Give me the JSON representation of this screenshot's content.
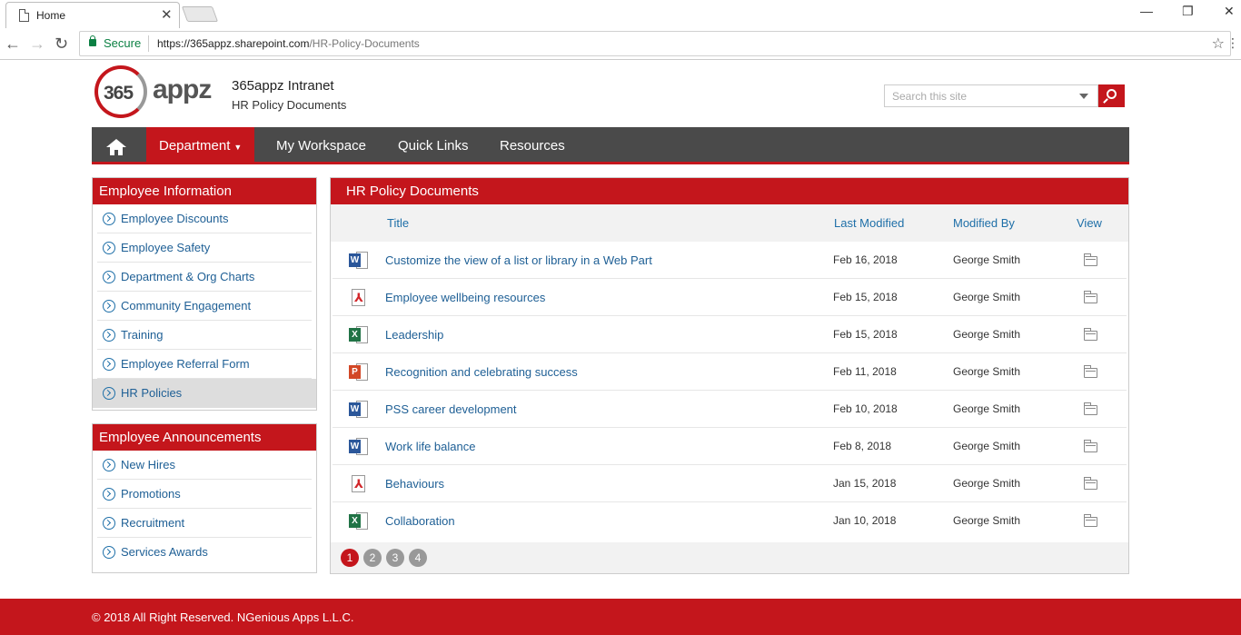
{
  "browser": {
    "tab_title": "Home",
    "secure_label": "Secure",
    "url_scheme_domain": "https://365appz.sharepoint.com",
    "url_path": "/HR-Policy-Documents"
  },
  "header": {
    "logo_number": "365",
    "logo_word": "appz",
    "site_title": "365appz Intranet",
    "site_subtitle": "HR Policy Documents",
    "search_placeholder": "Search this site"
  },
  "nav": {
    "items": [
      {
        "label": "Department"
      },
      {
        "label": "My Workspace"
      },
      {
        "label": "Quick Links"
      },
      {
        "label": "Resources"
      }
    ]
  },
  "employee_info": {
    "heading": "Employee Information",
    "items": [
      {
        "label": "Employee Discounts"
      },
      {
        "label": "Employee Safety"
      },
      {
        "label": "Department & Org Charts"
      },
      {
        "label": "Community Engagement"
      },
      {
        "label": "Training"
      },
      {
        "label": "Employee Referral Form"
      },
      {
        "label": "HR Policies"
      }
    ]
  },
  "announcements": {
    "heading": "Employee Announcements",
    "items": [
      {
        "label": "New Hires"
      },
      {
        "label": "Promotions"
      },
      {
        "label": "Recruitment"
      },
      {
        "label": "Services Awards"
      }
    ]
  },
  "docs": {
    "heading": "HR Policy Documents",
    "columns": {
      "title": "Title",
      "modified": "Last Modified",
      "by": "Modified By",
      "view": "View"
    },
    "rows": [
      {
        "type": "word",
        "icon_letter": "W",
        "title": "Customize the view of a list or library in a Web Part",
        "date": "Feb 16, 2018",
        "by": "George Smith"
      },
      {
        "type": "pdf",
        "icon_letter": "⅄",
        "title": "Employee wellbeing resources",
        "date": "Feb 15, 2018",
        "by": "George Smith"
      },
      {
        "type": "excel",
        "icon_letter": "X",
        "title": "Leadership",
        "date": "Feb 15, 2018",
        "by": "George Smith"
      },
      {
        "type": "ppt",
        "icon_letter": "P",
        "title": "Recognition and celebrating success",
        "date": "Feb 11, 2018",
        "by": "George Smith"
      },
      {
        "type": "word",
        "icon_letter": "W",
        "title": "PSS career development",
        "date": "Feb 10, 2018",
        "by": "George Smith"
      },
      {
        "type": "word",
        "icon_letter": "W",
        "title": "Work life balance",
        "date": "Feb 8, 2018",
        "by": "George Smith"
      },
      {
        "type": "pdf",
        "icon_letter": "⅄",
        "title": "Behaviours",
        "date": "Jan 15, 2018",
        "by": "George Smith"
      },
      {
        "type": "excel",
        "icon_letter": "X",
        "title": "Collaboration",
        "date": "Jan 10, 2018",
        "by": "George Smith"
      }
    ],
    "pages": [
      "1",
      "2",
      "3",
      "4"
    ],
    "current_page": "1"
  },
  "footer": {
    "text": "© 2018 All Right Reserved. NGenious Apps L.L.C."
  },
  "colors": {
    "brand_red": "#c4161c",
    "nav_dark": "#4a4a4a",
    "link_blue": "#1e5f95"
  }
}
